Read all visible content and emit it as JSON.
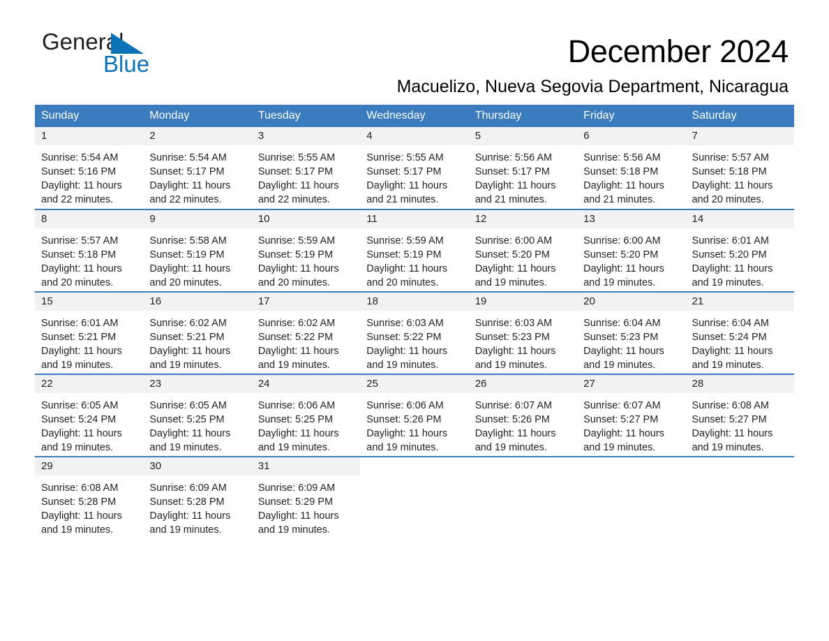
{
  "brand": {
    "name_part1": "General",
    "name_part2": "Blue",
    "triangle_color": "#0c72b8",
    "text_color": "#231f20"
  },
  "header": {
    "month_title": "December 2024",
    "location": "Macuelizo, Nueva Segovia Department, Nicaragua"
  },
  "theme": {
    "header_blue": "#3a7cbe",
    "daynum_bg": "#f2f2f2",
    "text": "#222222"
  },
  "calendar": {
    "weekday_headers": [
      "Sunday",
      "Monday",
      "Tuesday",
      "Wednesday",
      "Thursday",
      "Friday",
      "Saturday"
    ],
    "weeks": [
      [
        {
          "day": "1",
          "sunrise": "Sunrise: 5:54 AM",
          "sunset": "Sunset: 5:16 PM",
          "daylight_line1": "Daylight: 11 hours",
          "daylight_line2": "and 22 minutes."
        },
        {
          "day": "2",
          "sunrise": "Sunrise: 5:54 AM",
          "sunset": "Sunset: 5:17 PM",
          "daylight_line1": "Daylight: 11 hours",
          "daylight_line2": "and 22 minutes."
        },
        {
          "day": "3",
          "sunrise": "Sunrise: 5:55 AM",
          "sunset": "Sunset: 5:17 PM",
          "daylight_line1": "Daylight: 11 hours",
          "daylight_line2": "and 22 minutes."
        },
        {
          "day": "4",
          "sunrise": "Sunrise: 5:55 AM",
          "sunset": "Sunset: 5:17 PM",
          "daylight_line1": "Daylight: 11 hours",
          "daylight_line2": "and 21 minutes."
        },
        {
          "day": "5",
          "sunrise": "Sunrise: 5:56 AM",
          "sunset": "Sunset: 5:17 PM",
          "daylight_line1": "Daylight: 11 hours",
          "daylight_line2": "and 21 minutes."
        },
        {
          "day": "6",
          "sunrise": "Sunrise: 5:56 AM",
          "sunset": "Sunset: 5:18 PM",
          "daylight_line1": "Daylight: 11 hours",
          "daylight_line2": "and 21 minutes."
        },
        {
          "day": "7",
          "sunrise": "Sunrise: 5:57 AM",
          "sunset": "Sunset: 5:18 PM",
          "daylight_line1": "Daylight: 11 hours",
          "daylight_line2": "and 20 minutes."
        }
      ],
      [
        {
          "day": "8",
          "sunrise": "Sunrise: 5:57 AM",
          "sunset": "Sunset: 5:18 PM",
          "daylight_line1": "Daylight: 11 hours",
          "daylight_line2": "and 20 minutes."
        },
        {
          "day": "9",
          "sunrise": "Sunrise: 5:58 AM",
          "sunset": "Sunset: 5:19 PM",
          "daylight_line1": "Daylight: 11 hours",
          "daylight_line2": "and 20 minutes."
        },
        {
          "day": "10",
          "sunrise": "Sunrise: 5:59 AM",
          "sunset": "Sunset: 5:19 PM",
          "daylight_line1": "Daylight: 11 hours",
          "daylight_line2": "and 20 minutes."
        },
        {
          "day": "11",
          "sunrise": "Sunrise: 5:59 AM",
          "sunset": "Sunset: 5:19 PM",
          "daylight_line1": "Daylight: 11 hours",
          "daylight_line2": "and 20 minutes."
        },
        {
          "day": "12",
          "sunrise": "Sunrise: 6:00 AM",
          "sunset": "Sunset: 5:20 PM",
          "daylight_line1": "Daylight: 11 hours",
          "daylight_line2": "and 19 minutes."
        },
        {
          "day": "13",
          "sunrise": "Sunrise: 6:00 AM",
          "sunset": "Sunset: 5:20 PM",
          "daylight_line1": "Daylight: 11 hours",
          "daylight_line2": "and 19 minutes."
        },
        {
          "day": "14",
          "sunrise": "Sunrise: 6:01 AM",
          "sunset": "Sunset: 5:20 PM",
          "daylight_line1": "Daylight: 11 hours",
          "daylight_line2": "and 19 minutes."
        }
      ],
      [
        {
          "day": "15",
          "sunrise": "Sunrise: 6:01 AM",
          "sunset": "Sunset: 5:21 PM",
          "daylight_line1": "Daylight: 11 hours",
          "daylight_line2": "and 19 minutes."
        },
        {
          "day": "16",
          "sunrise": "Sunrise: 6:02 AM",
          "sunset": "Sunset: 5:21 PM",
          "daylight_line1": "Daylight: 11 hours",
          "daylight_line2": "and 19 minutes."
        },
        {
          "day": "17",
          "sunrise": "Sunrise: 6:02 AM",
          "sunset": "Sunset: 5:22 PM",
          "daylight_line1": "Daylight: 11 hours",
          "daylight_line2": "and 19 minutes."
        },
        {
          "day": "18",
          "sunrise": "Sunrise: 6:03 AM",
          "sunset": "Sunset: 5:22 PM",
          "daylight_line1": "Daylight: 11 hours",
          "daylight_line2": "and 19 minutes."
        },
        {
          "day": "19",
          "sunrise": "Sunrise: 6:03 AM",
          "sunset": "Sunset: 5:23 PM",
          "daylight_line1": "Daylight: 11 hours",
          "daylight_line2": "and 19 minutes."
        },
        {
          "day": "20",
          "sunrise": "Sunrise: 6:04 AM",
          "sunset": "Sunset: 5:23 PM",
          "daylight_line1": "Daylight: 11 hours",
          "daylight_line2": "and 19 minutes."
        },
        {
          "day": "21",
          "sunrise": "Sunrise: 6:04 AM",
          "sunset": "Sunset: 5:24 PM",
          "daylight_line1": "Daylight: 11 hours",
          "daylight_line2": "and 19 minutes."
        }
      ],
      [
        {
          "day": "22",
          "sunrise": "Sunrise: 6:05 AM",
          "sunset": "Sunset: 5:24 PM",
          "daylight_line1": "Daylight: 11 hours",
          "daylight_line2": "and 19 minutes."
        },
        {
          "day": "23",
          "sunrise": "Sunrise: 6:05 AM",
          "sunset": "Sunset: 5:25 PM",
          "daylight_line1": "Daylight: 11 hours",
          "daylight_line2": "and 19 minutes."
        },
        {
          "day": "24",
          "sunrise": "Sunrise: 6:06 AM",
          "sunset": "Sunset: 5:25 PM",
          "daylight_line1": "Daylight: 11 hours",
          "daylight_line2": "and 19 minutes."
        },
        {
          "day": "25",
          "sunrise": "Sunrise: 6:06 AM",
          "sunset": "Sunset: 5:26 PM",
          "daylight_line1": "Daylight: 11 hours",
          "daylight_line2": "and 19 minutes."
        },
        {
          "day": "26",
          "sunrise": "Sunrise: 6:07 AM",
          "sunset": "Sunset: 5:26 PM",
          "daylight_line1": "Daylight: 11 hours",
          "daylight_line2": "and 19 minutes."
        },
        {
          "day": "27",
          "sunrise": "Sunrise: 6:07 AM",
          "sunset": "Sunset: 5:27 PM",
          "daylight_line1": "Daylight: 11 hours",
          "daylight_line2": "and 19 minutes."
        },
        {
          "day": "28",
          "sunrise": "Sunrise: 6:08 AM",
          "sunset": "Sunset: 5:27 PM",
          "daylight_line1": "Daylight: 11 hours",
          "daylight_line2": "and 19 minutes."
        }
      ],
      [
        {
          "day": "29",
          "sunrise": "Sunrise: 6:08 AM",
          "sunset": "Sunset: 5:28 PM",
          "daylight_line1": "Daylight: 11 hours",
          "daylight_line2": "and 19 minutes."
        },
        {
          "day": "30",
          "sunrise": "Sunrise: 6:09 AM",
          "sunset": "Sunset: 5:28 PM",
          "daylight_line1": "Daylight: 11 hours",
          "daylight_line2": "and 19 minutes."
        },
        {
          "day": "31",
          "sunrise": "Sunrise: 6:09 AM",
          "sunset": "Sunset: 5:29 PM",
          "daylight_line1": "Daylight: 11 hours",
          "daylight_line2": "and 19 minutes."
        },
        {
          "day": "",
          "sunrise": "",
          "sunset": "",
          "daylight_line1": "",
          "daylight_line2": ""
        },
        {
          "day": "",
          "sunrise": "",
          "sunset": "",
          "daylight_line1": "",
          "daylight_line2": ""
        },
        {
          "day": "",
          "sunrise": "",
          "sunset": "",
          "daylight_line1": "",
          "daylight_line2": ""
        },
        {
          "day": "",
          "sunrise": "",
          "sunset": "",
          "daylight_line1": "",
          "daylight_line2": ""
        }
      ]
    ]
  }
}
